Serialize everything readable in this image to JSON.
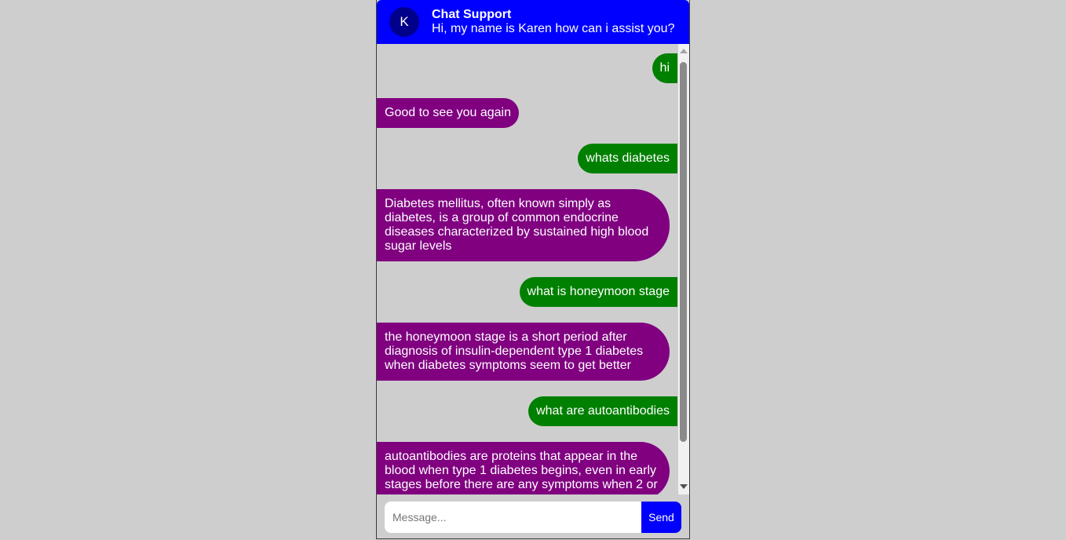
{
  "header": {
    "avatar_initial": "K",
    "title": "Chat Support",
    "subtitle": "Hi, my name is Karen how can i assist you?"
  },
  "messages": [
    {
      "sender": "user",
      "text": "hi"
    },
    {
      "sender": "bot",
      "text": "Good to see you again"
    },
    {
      "sender": "user",
      "text": "whats diabetes"
    },
    {
      "sender": "bot",
      "text": "Diabetes mellitus, often known simply as diabetes, is a group of common endocrine diseases characterized by sustained high blood sugar levels"
    },
    {
      "sender": "user",
      "text": "what is honeymoon stage"
    },
    {
      "sender": "bot",
      "text": "the honeymoon stage is a short period after diagnosis of insulin-dependent type 1 diabetes when diabetes symptoms seem to get better"
    },
    {
      "sender": "user",
      "text": "what are autoantibodies"
    },
    {
      "sender": "bot",
      "text": "autoantibodies are proteins that appear in the blood when type 1 diabetes begins, even in early stages before there are any symptoms when 2 or"
    }
  ],
  "composer": {
    "placeholder": "Message...",
    "send_label": "Send"
  },
  "colors": {
    "header": "#0000ff",
    "avatar": "#00008b",
    "user_bubble": "#008000",
    "bot_bubble": "#800080",
    "send_button": "#0000ff",
    "background": "#cecece"
  }
}
